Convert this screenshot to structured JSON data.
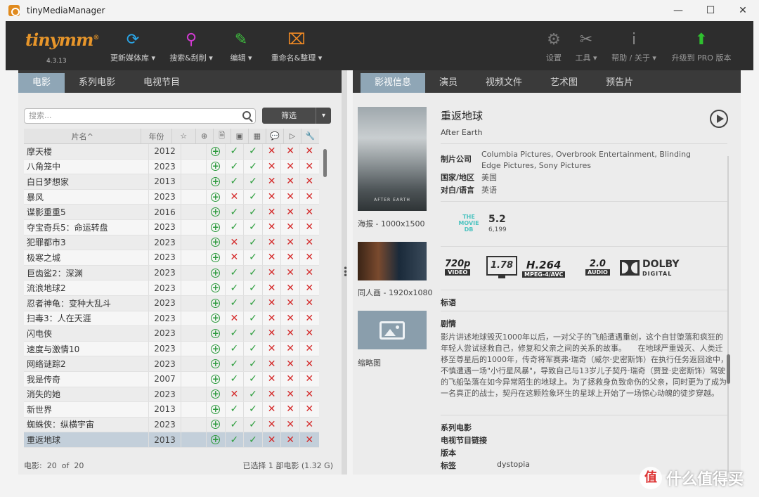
{
  "window": {
    "title": "tinyMediaManager",
    "controls": [
      "—",
      "☐",
      "✕"
    ]
  },
  "toolbar": {
    "logo": "tinymm",
    "logo_mark": "®",
    "version": "4.3.13",
    "buttons": [
      {
        "label": "更新媒体库 ▾",
        "icon": "refresh-icon",
        "glyph": "⟳",
        "color": "#2aa6e8"
      },
      {
        "label": "搜索&刮削 ▾",
        "icon": "search-icon",
        "glyph": "⚲",
        "color": "#d23ad2"
      },
      {
        "label": "编辑 ▾",
        "icon": "edit-icon",
        "glyph": "✎",
        "color": "#3fbf3f"
      },
      {
        "label": "重命名&整理 ▾",
        "icon": "rename-icon",
        "glyph": "⌧",
        "color": "#f08a24"
      }
    ],
    "right_buttons": [
      {
        "label": "设置",
        "icon": "gear-icon",
        "glyph": "⚙",
        "color": "#777"
      },
      {
        "label": "工具 ▾",
        "icon": "tools-icon",
        "glyph": "✂",
        "color": "#888"
      },
      {
        "label": "帮助 / 关于 ▾",
        "icon": "info-icon",
        "glyph": "ⅰ",
        "color": "#888"
      },
      {
        "label": "升级到 PRO 版本",
        "icon": "upgrade-arrow-icon",
        "glyph": "⬆",
        "color": "#2fc02f"
      }
    ]
  },
  "left_tabs": [
    "电影",
    "系列电影",
    "电视节目"
  ],
  "right_tabs": [
    "影视信息",
    "演员",
    "视频文件",
    "艺术图",
    "预告片"
  ],
  "search": {
    "placeholder": "搜索..."
  },
  "filter": {
    "label": "筛选"
  },
  "table": {
    "headers": {
      "title": "片名^",
      "year": "年份"
    },
    "rows": [
      {
        "title": "摩天楼",
        "year": "2012",
        "flags": [
          "ok",
          "ok",
          "no",
          "no",
          "no"
        ]
      },
      {
        "title": "八角笼中",
        "year": "2023",
        "flags": [
          "ok",
          "ok",
          "no",
          "no",
          "no"
        ]
      },
      {
        "title": "白日梦想家",
        "year": "2013",
        "flags": [
          "ok",
          "ok",
          "no",
          "no",
          "no"
        ]
      },
      {
        "title": "暴风",
        "year": "2023",
        "flags": [
          "no",
          "ok",
          "no",
          "no",
          "no"
        ]
      },
      {
        "title": "谍影重重5",
        "year": "2016",
        "flags": [
          "ok",
          "ok",
          "no",
          "no",
          "no"
        ]
      },
      {
        "title": "夺宝奇兵5：命运转盘",
        "year": "2023",
        "flags": [
          "ok",
          "ok",
          "no",
          "no",
          "no"
        ]
      },
      {
        "title": "犯罪都市3",
        "year": "2023",
        "flags": [
          "no",
          "ok",
          "no",
          "no",
          "no"
        ]
      },
      {
        "title": "极寒之城",
        "year": "2023",
        "flags": [
          "no",
          "ok",
          "no",
          "no",
          "no"
        ]
      },
      {
        "title": "巨齿鲨2：深渊",
        "year": "2023",
        "flags": [
          "ok",
          "ok",
          "no",
          "no",
          "no"
        ]
      },
      {
        "title": "流浪地球2",
        "year": "2023",
        "flags": [
          "ok",
          "ok",
          "no",
          "no",
          "no"
        ]
      },
      {
        "title": "忍者神龟：变种大乱斗",
        "year": "2023",
        "flags": [
          "ok",
          "ok",
          "no",
          "no",
          "no"
        ]
      },
      {
        "title": "扫毒3：人在天涯",
        "year": "2023",
        "flags": [
          "no",
          "ok",
          "no",
          "no",
          "no"
        ]
      },
      {
        "title": "闪电侠",
        "year": "2023",
        "flags": [
          "ok",
          "ok",
          "no",
          "no",
          "no"
        ]
      },
      {
        "title": "速度与激情10",
        "year": "2023",
        "flags": [
          "ok",
          "ok",
          "no",
          "no",
          "no"
        ]
      },
      {
        "title": "网络谜踪2",
        "year": "2023",
        "flags": [
          "ok",
          "ok",
          "no",
          "no",
          "no"
        ]
      },
      {
        "title": "我是传奇",
        "year": "2007",
        "flags": [
          "ok",
          "ok",
          "no",
          "no",
          "no"
        ]
      },
      {
        "title": "消失的她",
        "year": "2023",
        "flags": [
          "no",
          "ok",
          "no",
          "no",
          "no"
        ]
      },
      {
        "title": "新世界",
        "year": "2013",
        "flags": [
          "ok",
          "ok",
          "no",
          "no",
          "no"
        ]
      },
      {
        "title": "蜘蛛侠：纵横宇宙",
        "year": "2023",
        "flags": [
          "ok",
          "ok",
          "no",
          "no",
          "no"
        ]
      },
      {
        "title": "重返地球",
        "year": "2013",
        "flags": [
          "ok",
          "ok",
          "no",
          "no",
          "no"
        ],
        "selected": true
      }
    ]
  },
  "footer": {
    "count_label": "电影:",
    "count": "20",
    "of": "of",
    "total": "20",
    "selected": "已选择 1 部电影 (1.32 G)"
  },
  "artwork": {
    "poster_caption": "海报 - 1000x1500",
    "poster_text": "AFTER EARTH",
    "fanart_caption": "同人画 - 1920x1080",
    "thumb_caption": "缩略图"
  },
  "movie": {
    "title": "重返地球",
    "original_title": "After Earth",
    "production_label": "制片公司",
    "production": "Columbia Pictures, Overbrook Entertainment, Blinding Edge Pictures, Sony Pictures",
    "country_label": "国家/地区",
    "country": "美国",
    "language_label": "对白/语言",
    "language": "英语",
    "tmdb_logo": "THE MOVIE DB",
    "rating": "5.2",
    "votes": "6,199",
    "media": {
      "resolution": "720p",
      "resolution_sub": "VIDEO",
      "aspect": "1.78",
      "codec": "H.264",
      "codec_sub": "MPEG-4/AVC",
      "audio": "2.0",
      "audio_sub": "AUDIO",
      "dolby": "DOLBY",
      "dolby_sub": "DIGITAL"
    },
    "tagline_label": "标语",
    "plot_label": "剧情",
    "plot": "影片讲述地球毁灭1000年以后，一对父子的飞船遭遇重创，这个自甘堕落和疯狂的年轻人尝试拯救自己，修复和父亲之间的关系的故事。　　在地球严重毁灭、人类迁移至尊星后的1000年，传奇将军赛弗·瑞奇（威尔·史密斯饰）在执行任务返回途中，不慎遭遇一场\"小行星风暴\"，导致自己与13岁儿子契丹·瑞奇（贾登·史密斯饰）驾驶的飞船坠落在如今异常陌生的地球上。为了拯救身负致命伤的父亲，同时更为了成为一名真正的战士，契丹在这颗险象环生的星球上开始了一场惊心动魄的徒步穿越。",
    "collection_label": "系列电影",
    "tv_link_label": "电视节目链接",
    "edition_label": "版本",
    "tags_label": "标签",
    "tags": "dystopia"
  },
  "watermark": {
    "badge": "值",
    "text": "什么值得买"
  }
}
